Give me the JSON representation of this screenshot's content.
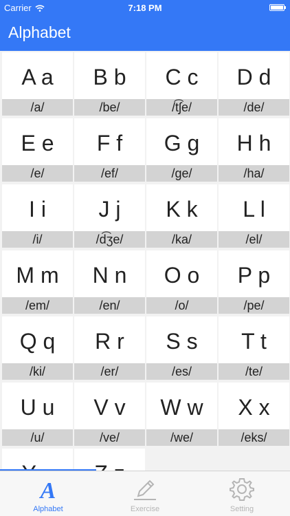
{
  "status_bar": {
    "carrier": "Carrier",
    "time": "7:18 PM"
  },
  "nav": {
    "title": "Alphabet"
  },
  "letters": [
    {
      "letter": "A a",
      "ipa": "/a/"
    },
    {
      "letter": "B b",
      "ipa": "/be/"
    },
    {
      "letter": "C c",
      "ipa": "/t͡ʃe/"
    },
    {
      "letter": "D d",
      "ipa": "/de/"
    },
    {
      "letter": "E e",
      "ipa": "/e/"
    },
    {
      "letter": "F f",
      "ipa": "/ef/"
    },
    {
      "letter": "G g",
      "ipa": "/ge/"
    },
    {
      "letter": "H h",
      "ipa": "/ha/"
    },
    {
      "letter": "I i",
      "ipa": "/i/"
    },
    {
      "letter": "J j",
      "ipa": "/d͡ʒe/"
    },
    {
      "letter": "K k",
      "ipa": "/ka/"
    },
    {
      "letter": "L l",
      "ipa": "/el/"
    },
    {
      "letter": "M m",
      "ipa": "/em/"
    },
    {
      "letter": "N n",
      "ipa": "/en/"
    },
    {
      "letter": "O o",
      "ipa": "/o/"
    },
    {
      "letter": "P p",
      "ipa": "/pe/"
    },
    {
      "letter": "Q q",
      "ipa": "/ki/"
    },
    {
      "letter": "R r",
      "ipa": "/er/"
    },
    {
      "letter": "S s",
      "ipa": "/es/"
    },
    {
      "letter": "T t",
      "ipa": "/te/"
    },
    {
      "letter": "U u",
      "ipa": "/u/"
    },
    {
      "letter": "V v",
      "ipa": "/ve/"
    },
    {
      "letter": "W w",
      "ipa": "/we/"
    },
    {
      "letter": "X x",
      "ipa": "/eks/"
    },
    {
      "letter": "Y y",
      "ipa": ""
    },
    {
      "letter": "Z z",
      "ipa": ""
    }
  ],
  "tabs": [
    {
      "label": "Alphabet",
      "icon": "letter-a-icon",
      "active": true
    },
    {
      "label": "Exercise",
      "icon": "pencil-icon",
      "active": false
    },
    {
      "label": "Setting",
      "icon": "gear-icon",
      "active": false
    }
  ],
  "colors": {
    "accent": "#3478f6",
    "cell_bg": "#ffffff",
    "ipa_bg": "#d3d3d3",
    "inactive_tab": "#b5b5b5"
  }
}
